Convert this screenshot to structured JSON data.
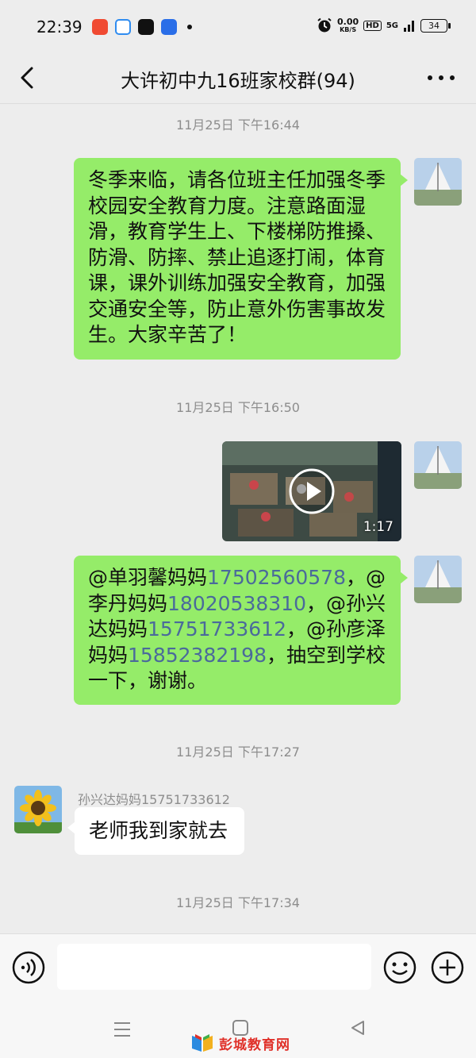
{
  "status_bar": {
    "time": "22:39",
    "net_speed_value": "0.00",
    "net_speed_unit": "KB/S",
    "hd_label": "HD",
    "signal_label": "5G",
    "battery": "34",
    "app_icon_colors": [
      "#f04a32",
      "#2f8cf0",
      "#111111",
      "#2a6ee8"
    ]
  },
  "nav": {
    "title": "大许初中九16班家校群(94)"
  },
  "messages": {
    "ts1": "11月25日 下午16:44",
    "msg1": "冬季来临，请各位班主任加强冬季校园安全教育力度。注意路面湿滑，教育学生上、下楼梯防推搡、防滑、防摔、禁止追逐打闹，体育课，课外训练加强安全教育，加强交通安全等，防止意外伤害事故发生。大家辛苦了！",
    "ts2": "11月25日 下午16:50",
    "video_duration": "1:17",
    "msg3": {
      "m1": "@单羽馨妈妈",
      "p1": "17502560578",
      "s1": "，@李丹妈妈",
      "p2": "18020538310",
      "s2": "，@孙兴达妈妈",
      "p3": "15751733612",
      "s3": "，@孙彦泽妈妈",
      "p4": "15852382198",
      "s4": "，抽空到学校一下，谢谢。"
    },
    "ts3": "11月25日 下午17:27",
    "sender4": "孙兴达妈妈15751733612",
    "msg4": "老师我到家就去",
    "ts4": "11月25日 下午17:34"
  },
  "input": {
    "placeholder": ""
  },
  "watermark": {
    "text": "彭城教育网"
  },
  "colors": {
    "outgoing_bubble": "#95ec69",
    "incoming_bubble": "#ffffff",
    "chat_background": "#ededed",
    "phone_link": "#4a6a9b",
    "watermark": "#e0312a"
  },
  "icons": [
    "back-icon",
    "more-icon",
    "play-icon",
    "voice-icon",
    "emoji-icon",
    "plus-icon",
    "menu-icon",
    "home-icon",
    "nav-back-icon",
    "alarm-icon"
  ]
}
